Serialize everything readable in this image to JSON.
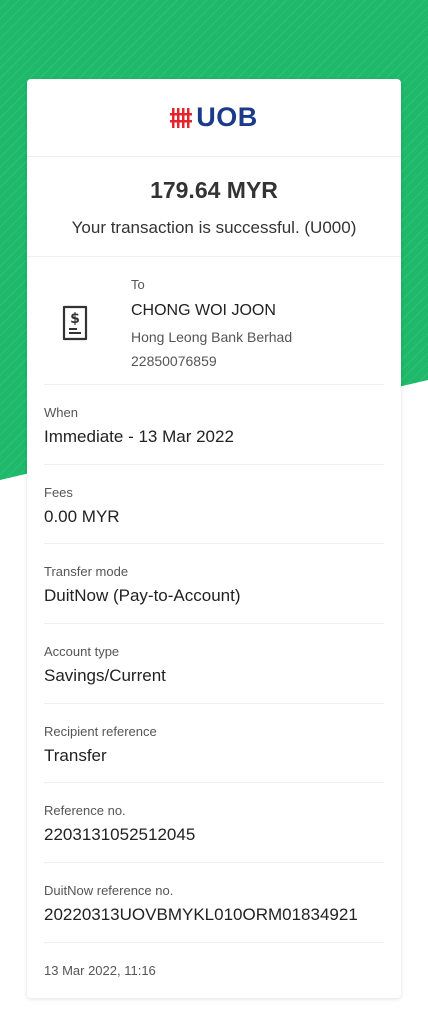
{
  "brand": {
    "logo_text": "UOB",
    "logo_color": "#1c3a8c",
    "mark_color": "#e1262d"
  },
  "accent_green": "#1fb96a",
  "transaction": {
    "amount": "179.64 MYR",
    "status": "Your transaction is successful. (U000)"
  },
  "recipient": {
    "label": "To",
    "icon": "receipt-icon",
    "name": "CHONG WOI JOON",
    "bank": "Hong Leong Bank Berhad",
    "account": "22850076859"
  },
  "details": [
    {
      "label": "When",
      "value": "Immediate - 13 Mar 2022"
    },
    {
      "label": "Fees",
      "value": "0.00 MYR"
    },
    {
      "label": "Transfer mode",
      "value": "DuitNow (Pay-to-Account)"
    },
    {
      "label": "Account type",
      "value": "Savings/Current"
    },
    {
      "label": "Recipient reference",
      "value": "Transfer"
    },
    {
      "label": "Reference no.",
      "value": "2203131052512045"
    },
    {
      "label": "DuitNow reference no.",
      "value": "20220313UOVBMYKL010ORM01834921"
    }
  ],
  "timestamp": "13 Mar 2022, 11:16"
}
